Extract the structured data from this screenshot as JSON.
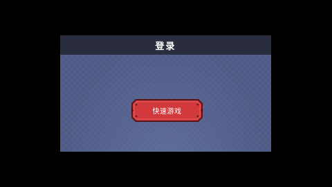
{
  "panel": {
    "title": "登录",
    "quick_play_label": "快速游戏"
  },
  "colors": {
    "background": "#000000",
    "panel_body": "#4f5b86",
    "panel_header": "#2a2d3d",
    "button_fill": "#d2393c",
    "button_border": "#5a1518"
  },
  "icons": {
    "button_corner_ornament": "diamond-ornament-icon"
  }
}
